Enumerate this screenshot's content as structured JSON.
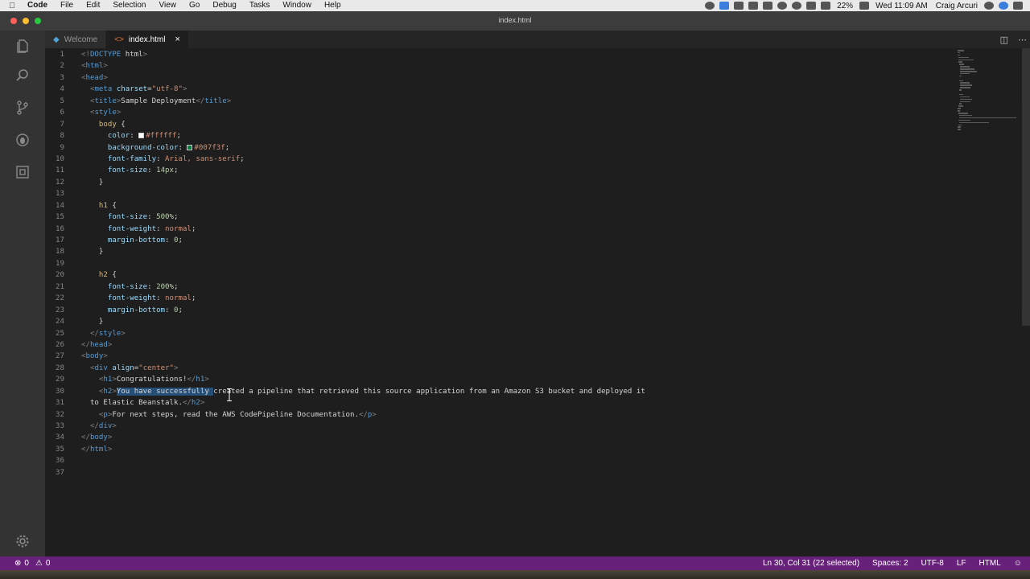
{
  "menubar": {
    "apple": "",
    "items": [
      "Code",
      "File",
      "Edit",
      "Selection",
      "View",
      "Go",
      "Debug",
      "Tasks",
      "Window",
      "Help"
    ],
    "battery": "22%",
    "datetime": "Wed 11:09 AM",
    "user": "Craig Arcuri"
  },
  "window": {
    "title": "index.html"
  },
  "tabs": [
    {
      "label": "Welcome",
      "icon": "vscode-icon"
    },
    {
      "label": "index.html",
      "icon": "html-file-icon",
      "close": "×"
    }
  ],
  "activity_icons": [
    "explorer-icon",
    "search-icon",
    "source-control-icon",
    "debug-icon",
    "extensions-icon",
    "settings-gear-icon"
  ],
  "editor": {
    "lines": [
      "<!DOCTYPE html>",
      "<html>",
      "<head>",
      "  <meta charset=\"utf-8\">",
      "  <title>Sample Deployment</title>",
      "  <style>",
      "    body {",
      "      color: #ffffff;",
      "      background-color: #007f3f;",
      "      font-family: Arial, sans-serif;",
      "      font-size: 14px;",
      "    }",
      "",
      "    h1 {",
      "      font-size: 500%;",
      "      font-weight: normal;",
      "      margin-bottom: 0;",
      "    }",
      "",
      "    h2 {",
      "      font-size: 200%;",
      "      font-weight: normal;",
      "      margin-bottom: 0;",
      "    }",
      "  </style>",
      "</head>",
      "<body>",
      "  <div align=\"center\">",
      "    <h1>Congratulations!</h1>",
      "    <h2>You have successfully created a pipeline that retrieved this source application from an Amazon S3 bucket and deployed it",
      "  to Elastic Beanstalk.</h2>",
      "    <p>For next steps, read the AWS CodePipeline Documentation.</p>",
      "  </div>",
      "</body>",
      "</html>",
      "",
      ""
    ]
  },
  "status": {
    "errors": "0",
    "warnings": "0",
    "position": "Ln 30, Col 31 (22 selected)",
    "spaces": "Spaces: 2",
    "encoding": "UTF-8",
    "eol": "LF",
    "language": "HTML"
  },
  "colors": {
    "status_bar": "#68217a",
    "swatch_white": "#ffffff",
    "swatch_green": "#007f3f"
  }
}
